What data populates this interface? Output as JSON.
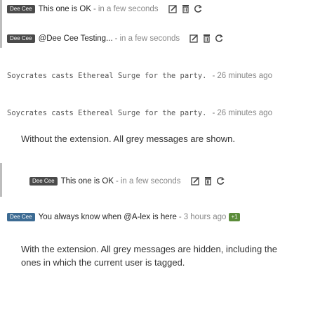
{
  "top": {
    "rows": [
      {
        "badge": "Dee Cee",
        "text": "This one is OK",
        "time": "in a few seconds"
      },
      {
        "badge": "Dee Cee",
        "text": "@Dee Cee Testing...",
        "time": "in a few seconds"
      }
    ],
    "system_rows": [
      {
        "text": "Soycrates casts Ethereal Surge for the party.",
        "time": "26 minutes ago"
      },
      {
        "text": "Soycrates casts Ethereal Surge for the party.",
        "time": "26 minutes ago"
      }
    ],
    "caption": "Without the extension. All grey messages are shown."
  },
  "bottom": {
    "rows": [
      {
        "badge": "Dee Cee",
        "text": "This one is OK",
        "time": "in a few seconds"
      }
    ],
    "tagged_row": {
      "badge": "Dee Cee",
      "text": "You always know when @A-lex is here",
      "time": "3 hours ago",
      "tag": "+1"
    },
    "caption": "With the extension. All grey messages are hidden, including the ones in which the current user is tagged."
  },
  "separator": "-"
}
